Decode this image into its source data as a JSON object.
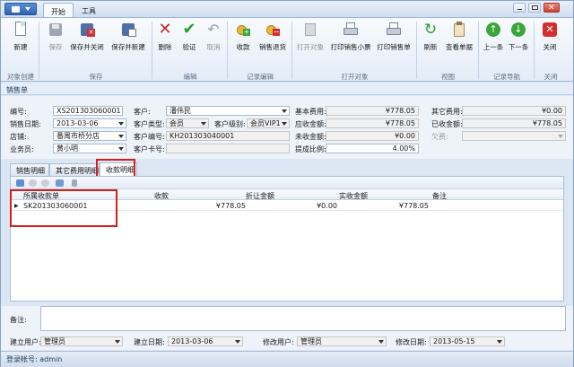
{
  "tabs": {
    "start": "开始",
    "tools": "工具"
  },
  "ribbon": {
    "new": "新建",
    "save": "保存",
    "save_close": "保存并关闭",
    "save_new": "保存并新建",
    "delete": "删除",
    "verify": "验证",
    "cancel": "取消",
    "receive": "收款",
    "sales_return": "销售退货",
    "open_obj": "打开对象",
    "print_ticket": "打印销售小票",
    "print_order": "打印销售单",
    "refresh": "刷新",
    "view_docs": "查看单据",
    "prev": "上一条",
    "next": "下一条",
    "close": "关闭",
    "groups": {
      "object_create": "对象创建",
      "save": "保存",
      "edit": "编辑",
      "record_edit": "记录编辑",
      "open_object": "打开对象",
      "view": "视图",
      "record_nav": "记录导航",
      "close": "关闭"
    }
  },
  "section_title": "销售单",
  "form": {
    "labels": {
      "number": "编号:",
      "customer": "客户:",
      "base_fee": "基本费用:",
      "other_fee": "其它费用:",
      "sale_date": "销售日期:",
      "customer_type": "客户类型:",
      "customer_level": "客户级别:",
      "receivable": "应收金额:",
      "received": "已收金额:",
      "store": "店铺:",
      "customer_no": "客户编号:",
      "unreceived": "未收金额:",
      "debt": "欠费:",
      "salesman": "业务员:",
      "customer_card": "客户卡号:",
      "commission": "提成比例:"
    },
    "values": {
      "number": "XS201303060001",
      "customer": "潘伟民",
      "base_fee": "¥778.05",
      "other_fee": "¥0.00",
      "sale_date": "2013-03-06",
      "customer_type": "会员",
      "customer_level": "会员VIP1",
      "receivable": "¥778.05",
      "received": "¥778.05",
      "store": "番禺市桥分店",
      "customer_no": "KH201303040001",
      "unreceived": "¥0.00",
      "debt": "",
      "salesman": "黄小明",
      "customer_card": "",
      "commission": "4.00%"
    }
  },
  "subtabs": [
    "销售明细",
    "其它费用明细",
    "收款明细"
  ],
  "grid": {
    "columns": [
      "所属收款单",
      "收款",
      "折让金额",
      "实收金额",
      "备注"
    ],
    "rows": [
      {
        "receipt": "SK201303060001",
        "amount": "¥778.05",
        "discount": "¥0.00",
        "actual": "¥778.05",
        "note": ""
      }
    ]
  },
  "memo_label": "备注:",
  "bottom": {
    "created_user_label": "建立用户:",
    "created_user": "管理员",
    "created_date_label": "建立日期:",
    "created_date": "2013-03-06",
    "modified_user_label": "修改用户:",
    "modified_user": "管理员",
    "modified_date_label": "修改日期:",
    "modified_date": "2013-05-15"
  },
  "status": "登录帐号: admin",
  "colors": {
    "highlight": "#d41e1e",
    "accent": "#2d63b2"
  }
}
